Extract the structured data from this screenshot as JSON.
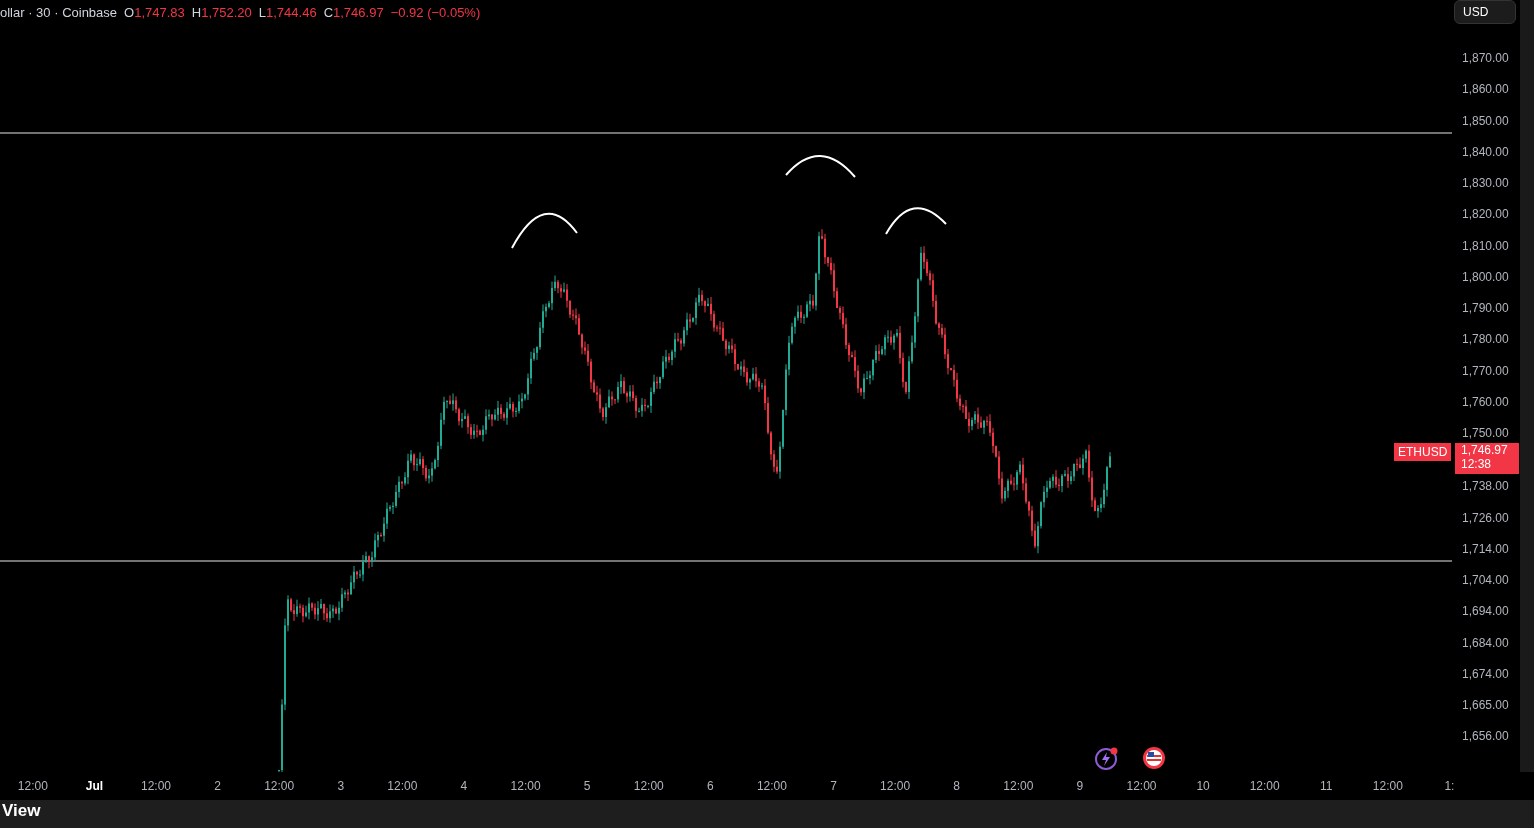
{
  "header": {
    "symbol": "ollar · 30 · Coinbase",
    "ohlc": [
      {
        "label": "O",
        "value": "1,747.83"
      },
      {
        "label": "H",
        "value": "1,752.20"
      },
      {
        "label": "L",
        "value": "1,744.46"
      },
      {
        "label": "C",
        "value": "1,746.97"
      }
    ],
    "change": "−0.92 (−0.05%)"
  },
  "currency_button": "USD",
  "price_axis": [
    "1,870.00",
    "1,860.00",
    "1,850.00",
    "1,840.00",
    "1,830.00",
    "1,820.00",
    "1,810.00",
    "1,800.00",
    "1,790.00",
    "1,780.00",
    "1,770.00",
    "1,760.00",
    "1,750.00",
    "1,738.00",
    "1,726.00",
    "1,714.00",
    "1,704.00",
    "1,694.00",
    "1,684.00",
    "1,674.00",
    "1,665.00",
    "1,656.00"
  ],
  "last_price": {
    "symbol": "ETHUSD",
    "price": "1,746.97",
    "countdown": "12:38"
  },
  "time_axis": [
    {
      "label": "12:00",
      "bold": false
    },
    {
      "label": "Jul",
      "bold": true
    },
    {
      "label": "12:00",
      "bold": false
    },
    {
      "label": "2",
      "bold": false
    },
    {
      "label": "12:00",
      "bold": false
    },
    {
      "label": "3",
      "bold": false
    },
    {
      "label": "12:00",
      "bold": false
    },
    {
      "label": "4",
      "bold": false
    },
    {
      "label": "12:00",
      "bold": false
    },
    {
      "label": "5",
      "bold": false
    },
    {
      "label": "12:00",
      "bold": false
    },
    {
      "label": "6",
      "bold": false
    },
    {
      "label": "12:00",
      "bold": false
    },
    {
      "label": "7",
      "bold": false
    },
    {
      "label": "12:00",
      "bold": false
    },
    {
      "label": "8",
      "bold": false
    },
    {
      "label": "12:00",
      "bold": false
    },
    {
      "label": "9",
      "bold": false
    },
    {
      "label": "12:00",
      "bold": false
    },
    {
      "label": "10",
      "bold": false
    },
    {
      "label": "12:00",
      "bold": false
    },
    {
      "label": "11",
      "bold": false
    },
    {
      "label": "12:00",
      "bold": false
    },
    {
      "label": "1:",
      "bold": false
    }
  ],
  "bottom_panel": {
    "title": "View"
  }
}
